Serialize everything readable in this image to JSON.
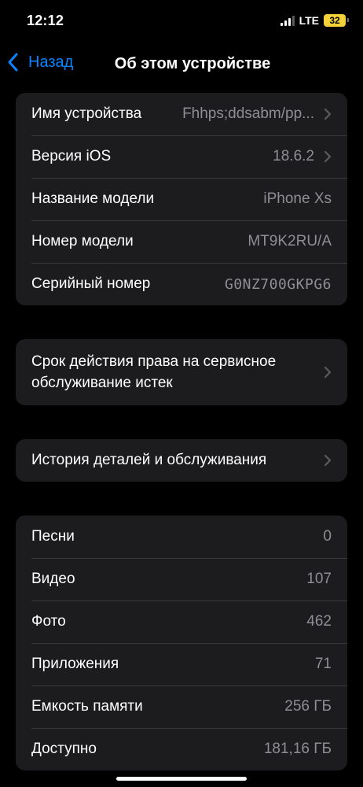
{
  "status_bar": {
    "time": "12:12",
    "network": "LTE",
    "battery": "32"
  },
  "nav": {
    "back_label": "Назад",
    "title": "Об этом устройстве"
  },
  "device": {
    "rows": [
      {
        "label": "Имя устройства",
        "value": "Fhhps;ddsabm/pp..."
      },
      {
        "label": "Версия iOS",
        "value": "18.6.2"
      },
      {
        "label": "Название модели",
        "value": "iPhone Xs"
      },
      {
        "label": "Номер модели",
        "value": "MT9K2RU/A"
      },
      {
        "label": "Серийный номер",
        "value": "G0NZ700GKPG6"
      }
    ]
  },
  "service": {
    "label": "Срок действия права на сервисное обслуживание истек"
  },
  "parts": {
    "label": "История деталей и обслуживания"
  },
  "stats": {
    "rows": [
      {
        "label": "Песни",
        "value": "0"
      },
      {
        "label": "Видео",
        "value": "107"
      },
      {
        "label": "Фото",
        "value": "462"
      },
      {
        "label": "Приложения",
        "value": "71"
      },
      {
        "label": "Емкость памяти",
        "value": "256 ГБ"
      },
      {
        "label": "Доступно",
        "value": "181,16 ГБ"
      }
    ]
  }
}
